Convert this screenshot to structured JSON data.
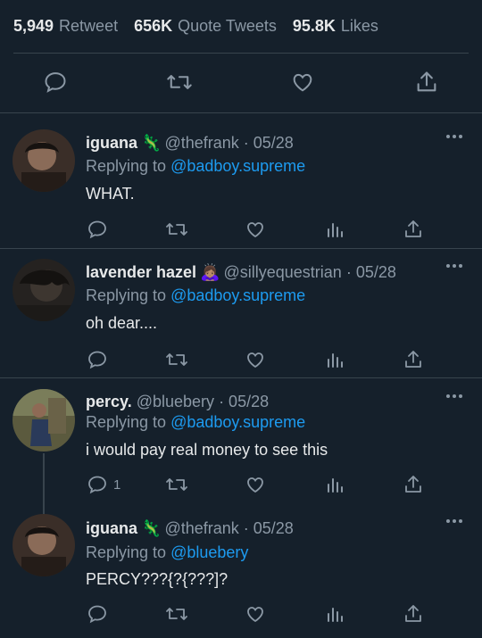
{
  "stats": {
    "retweets": "5,949",
    "retweets_label": "Retweet",
    "quotes": "656K",
    "quotes_label": "Quote Tweets",
    "likes": "95.8K",
    "likes_label": "Likes"
  },
  "tweets": [
    {
      "name": "iguana",
      "emoji": "🦎",
      "handle": "@thefrank",
      "date": "· 05/28",
      "replying_prefix": "Replying to",
      "replying_to": "@badboy.supreme",
      "text": "WHAT.",
      "reply_count": ""
    },
    {
      "name": "lavender hazel",
      "emoji": "🙇🏽‍♀️",
      "handle": "@sillyequestrian",
      "date": "· 05/28",
      "replying_prefix": "Replying to",
      "replying_to": "@badboy.supreme",
      "text": "oh dear....",
      "reply_count": ""
    },
    {
      "name": "percy.",
      "emoji": "",
      "handle": "@bluebery",
      "date": "· 05/28",
      "replying_prefix": "Replying to",
      "replying_to": "@badboy.supreme",
      "text": "i would pay real money to see this",
      "reply_count": "1"
    },
    {
      "name": "iguana",
      "emoji": "🦎",
      "handle": "@thefrank",
      "date": "· 05/28",
      "replying_prefix": "Replying to",
      "replying_to": "@bluebery",
      "text": "PERCY???{?{???]?",
      "reply_count": ""
    }
  ],
  "colors": {
    "background": "#15202b",
    "text": "#e7e9ea",
    "secondary": "#8b98a5",
    "link": "#1d9bf0",
    "divider": "#38444d"
  },
  "icons": [
    "reply-icon",
    "retweet-icon",
    "like-icon",
    "share-icon",
    "analytics-icon",
    "more-icon"
  ]
}
